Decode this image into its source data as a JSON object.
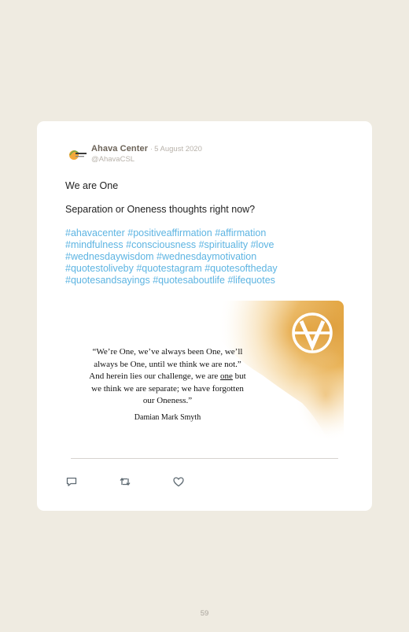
{
  "tweet": {
    "display_name": "Ahava Center",
    "separator": "·",
    "date": "5 August 2020",
    "handle": "@AhavaCSL",
    "paragraphs": [
      "We are One",
      "Separation or Oneness thoughts right now?"
    ],
    "hashtags": [
      "#ahavacenter",
      "#positiveaffirmation",
      "#affirmation",
      "#mindfulness",
      "#consciousness",
      "#spirituality",
      "#love",
      "#wednesdaywisdom",
      "#wednesdaymotivation",
      "#quotestoliveby",
      "#quotestagram",
      "#quotesoftheday",
      "#quotesandsayings",
      "#quotesaboutlife",
      "#lifequotes"
    ]
  },
  "media": {
    "quote_lines": [
      "“We’re One, we’ve always been One, we’ll",
      "always be One, until we think we are not.”",
      "And herein lies our challenge, we are one but",
      "we think we are separate; we have forgotten",
      "our Oneness.”"
    ],
    "attribution": "Damian Mark Smyth",
    "accent_color": "#e2a536"
  },
  "actions": {
    "reply_icon": "reply-icon",
    "retweet_icon": "retweet-icon",
    "like_icon": "heart-icon"
  },
  "colors": {
    "page_background": "#efebe1",
    "card_background": "#ffffff",
    "hashtag": "#5db4e2",
    "name": "#6b6257",
    "muted": "#b8b2aa"
  },
  "page": {
    "number": "59"
  }
}
